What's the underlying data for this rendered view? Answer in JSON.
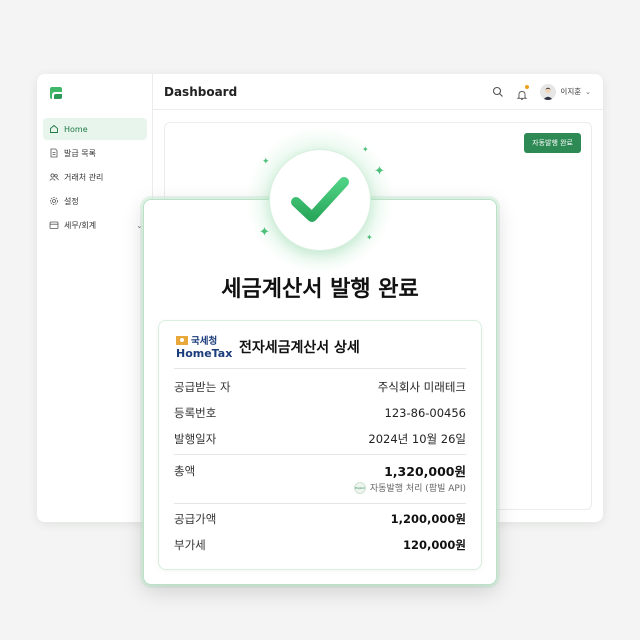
{
  "app": {
    "page_title": "Dashboard",
    "user_name": "이지훈",
    "status_button": "자동발행 완료"
  },
  "sidebar": {
    "items": [
      {
        "label": "Home",
        "icon": "home-icon",
        "active": true
      },
      {
        "label": "발급 목록",
        "icon": "document-icon"
      },
      {
        "label": "거래처 관리",
        "icon": "users-icon"
      },
      {
        "label": "설정",
        "icon": "gear-icon"
      },
      {
        "label": "세무/회계",
        "icon": "ledger-icon",
        "has_submenu": true
      }
    ]
  },
  "modal": {
    "title": "세금계산서 발행 완료",
    "detail": {
      "logo_kr": "국세청",
      "logo_en": "HomeTax",
      "heading": "전자세금계산서 상세",
      "rows": [
        {
          "label": "공급받는 자",
          "value": "주식회사 미래테크"
        },
        {
          "label": "등록번호",
          "value": "123-86-00456"
        },
        {
          "label": "발행일자",
          "value": "2024년 10월 26일"
        }
      ],
      "total_label": "총액",
      "total_value": "1,320,000원",
      "popbill_logo_text": "Popbill",
      "popbill_note": "자동발행 처리 (팝빌 API)",
      "breakdown": [
        {
          "label": "공급가액",
          "value": "1,200,000원"
        },
        {
          "label": "부가세",
          "value": "120,000원"
        }
      ]
    }
  },
  "colors": {
    "accent": "#2e8a55",
    "active_bg": "#e8f5ec",
    "check": "#3cbf6e",
    "brand_navy": "#1a3c7a"
  }
}
